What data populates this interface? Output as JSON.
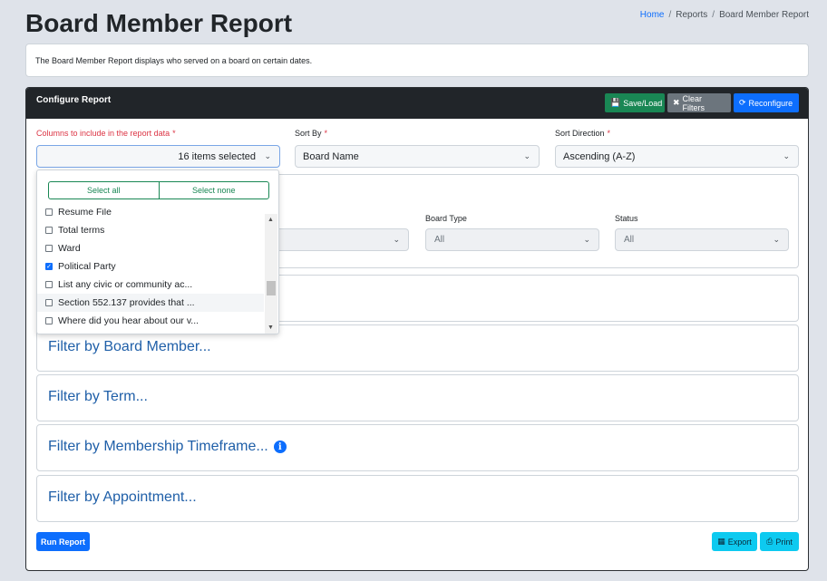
{
  "page": {
    "title": "Board Member Report",
    "description": "The Board Member Report displays who served on a board on certain dates."
  },
  "breadcrumb": [
    "Home",
    "Reports",
    "Board Member Report"
  ],
  "config": {
    "title": "Configure Report",
    "buttons": {
      "save_load": "Save/Load",
      "clear_filters": "Clear Filters",
      "reconfigure": "Reconfigure"
    },
    "columns_label": "Columns to include in the report data",
    "columns_value": "16 items selected",
    "sort_by_label": "Sort By",
    "sort_by_value": "Board Name",
    "sort_direction_label": "Sort Direction",
    "sort_direction_value": "Ascending (A-Z)",
    "required_mark": "*"
  },
  "filters": {
    "left_value": "",
    "board_type_label": "Board Type",
    "board_type_value": "All",
    "status_label": "Status",
    "status_value": "All",
    "board_member": "Filter by Board Member...",
    "term": "Filter by Term...",
    "membership_timeframe": "Filter by Membership Timeframe...",
    "appointment": "Filter by Appointment..."
  },
  "dropdown": {
    "select_all": "Select all",
    "select_none": "Select none",
    "items": [
      {
        "label": "Resume File",
        "checked": false
      },
      {
        "label": "Total terms",
        "checked": false
      },
      {
        "label": "Ward",
        "checked": false
      },
      {
        "label": "Political Party",
        "checked": true
      },
      {
        "label": "List any civic or community ac...",
        "checked": false
      },
      {
        "label": "Section 552.137 provides that ...",
        "checked": false
      },
      {
        "label": "Where did you hear about our v...",
        "checked": false
      }
    ]
  },
  "actions": {
    "run_report": "Run Report",
    "export": "Export",
    "print": "Print"
  },
  "colors": {
    "primary": "#0d6efd",
    "success": "#198754",
    "secondary": "#6c757d",
    "info": "#0dcaf0",
    "dark_header": "#212529",
    "heading_link": "#1f5fa8"
  }
}
